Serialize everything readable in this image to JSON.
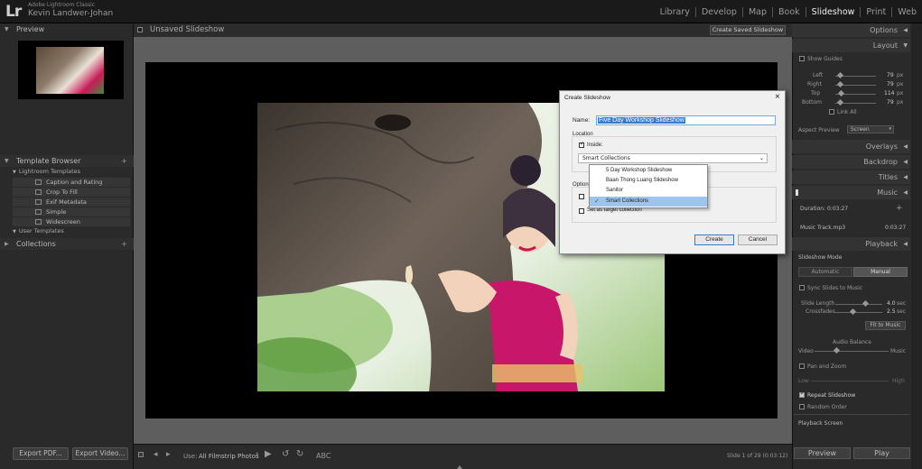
{
  "app": {
    "logo": "Lr",
    "name": "Adobe Lightroom Classic",
    "user": "Kevin Landwer-Johan"
  },
  "modules": [
    "Library",
    "Develop",
    "Map",
    "Book",
    "Slideshow",
    "Print",
    "Web"
  ],
  "active_module": "Slideshow",
  "left_panel": {
    "preview_label": "Preview",
    "template_browser_label": "Template Browser",
    "lightroom_templates_label": "Lightroom Templates",
    "templates": [
      "Caption and Rating",
      "Crop To Fill",
      "Exif Metadata",
      "Simple",
      "Widescreen"
    ],
    "user_templates_label": "User Templates",
    "collections_label": "Collections",
    "export_pdf": "Export PDF...",
    "export_video": "Export Video..."
  },
  "center": {
    "title": "Unsaved Slideshow",
    "save_button": "Create Saved Slideshow"
  },
  "toolbar": {
    "use_label": "Use:",
    "use_value": "All Filmstrip Photos",
    "abc": "ABC",
    "slide_info": "Slide 1 of 29 (0:03:12)"
  },
  "right_panel": {
    "options": "Options",
    "layout": "Layout",
    "show_guides": "Show Guides",
    "guides": [
      {
        "label": "Left",
        "value": "79",
        "unit": "px"
      },
      {
        "label": "Right",
        "value": "79",
        "unit": "px"
      },
      {
        "label": "Top",
        "value": "114",
        "unit": "px"
      },
      {
        "label": "Bottom",
        "value": "79",
        "unit": "px"
      }
    ],
    "link_all": "Link All",
    "aspect_preview_label": "Aspect Preview",
    "aspect_preview_value": "Screen",
    "overlays": "Overlays",
    "backdrop": "Backdrop",
    "titles": "Titles",
    "music": "Music",
    "duration": "Duration: 0:03:27",
    "music_track": "Music Track.mp3",
    "music_track_duration": "0:03:27",
    "playback": "Playback",
    "slideshow_mode": "Slideshow Mode",
    "automatic": "Automatic",
    "manual": "Manual",
    "sync_slides": "Sync Slides to Music",
    "slide_length_label": "Slide Length",
    "slide_length_value": "4.0",
    "slide_length_unit": "sec",
    "crossfades_label": "Crossfades",
    "crossfades_value": "2.5",
    "crossfades_unit": "sec",
    "fit_to_music": "Fit to Music",
    "audio_balance": "Audio Balance",
    "video": "Video",
    "music_label": "Music",
    "pan_zoom": "Pan and Zoom",
    "low": "Low",
    "high": "High",
    "repeat": "Repeat Slideshow",
    "random": "Random Order",
    "playback_screen": "Playback Screen",
    "preview_btn": "Preview",
    "play_btn": "Play"
  },
  "dialog": {
    "title": "Create Slideshow",
    "name_label": "Name:",
    "name_value": "Five Day Workshop Slideshow",
    "location_label": "Location",
    "inside_label": "Inside:",
    "combo_value": "Smart Collections",
    "dropdown": [
      {
        "label": "5 Day Workshop Slideshow",
        "selected": false
      },
      {
        "label": "Baan Thong Luang Slideshow",
        "selected": false
      },
      {
        "label": "Sanitor",
        "selected": false
      },
      {
        "label": "Smart Collections",
        "selected": true
      }
    ],
    "options_label": "Options",
    "set_target": "Set as target collection",
    "create": "Create",
    "cancel": "Cancel"
  }
}
